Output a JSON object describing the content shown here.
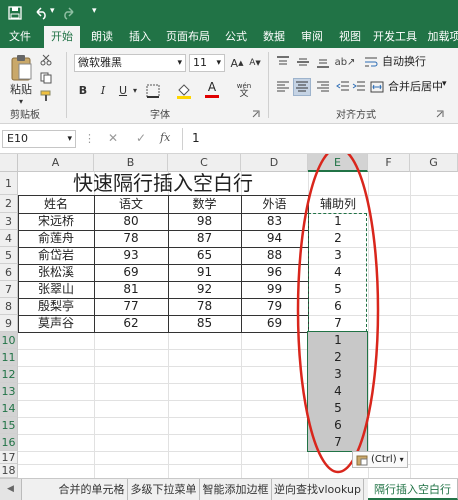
{
  "colors": {
    "brand": "#217346",
    "highlight_oval": "#d9261c",
    "selection_fill": "#c8c8c8"
  },
  "titlebar": {
    "autosave_icon": "save-icon",
    "undo_icon": "undo-icon",
    "redo_icon": "redo-icon",
    "customize_icon": "chevron-down-icon"
  },
  "menu": [
    "文件",
    "开始",
    "朗读",
    "插入",
    "页面布局",
    "公式",
    "数据",
    "审阅",
    "视图",
    "开发工具",
    "加载项"
  ],
  "ribbon": {
    "paste_label": "粘贴",
    "clipboard_label": "剪贴板",
    "font_name": "微软雅黑",
    "font_size": "11",
    "font_group_label": "字体",
    "bold": "B",
    "italic": "I",
    "underline": "U",
    "wen_label": "wén\n文",
    "wrap_text": "自动换行",
    "merge_center": "合并后居中",
    "align_group_label": "对齐方式"
  },
  "formula_bar": {
    "name_box": "E10",
    "fx": "fx",
    "value": "1"
  },
  "sheet": {
    "columns": [
      "A",
      "B",
      "C",
      "D",
      "E",
      "F",
      "G"
    ],
    "rows": [
      "1",
      "2",
      "3",
      "4",
      "5",
      "6",
      "7",
      "8",
      "9",
      "10",
      "11",
      "12",
      "13",
      "14",
      "15",
      "16",
      "17",
      "18"
    ],
    "title": "快速隔行插入空白行",
    "headers": [
      "姓名",
      "语文",
      "数学",
      "外语",
      "辅助列"
    ],
    "data": [
      [
        "宋远桥",
        "80",
        "98",
        "83",
        "1"
      ],
      [
        "俞莲舟",
        "78",
        "87",
        "94",
        "2"
      ],
      [
        "俞岱岩",
        "93",
        "65",
        "88",
        "3"
      ],
      [
        "张松溪",
        "69",
        "91",
        "96",
        "4"
      ],
      [
        "张翠山",
        "81",
        "92",
        "99",
        "5"
      ],
      [
        "殷梨亭",
        "77",
        "78",
        "79",
        "6"
      ],
      [
        "莫声谷",
        "62",
        "85",
        "69",
        "7"
      ]
    ],
    "helper_copy": [
      "1",
      "2",
      "3",
      "4",
      "5",
      "6",
      "7"
    ],
    "paste_options_label": "(Ctrl)"
  },
  "tabs": [
    "合并的单元格",
    "多级下拉菜单",
    "智能添加边框",
    "逆向查找vlookup",
    "隔行插入空白行"
  ],
  "tab_nav": "◀"
}
